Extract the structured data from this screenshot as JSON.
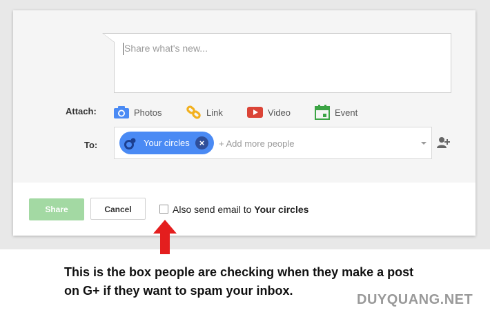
{
  "compose": {
    "placeholder": "Share what's new..."
  },
  "attach": {
    "label": "Attach:",
    "items": [
      {
        "label": "Photos",
        "icon": "camera-icon",
        "color": "#4a8af4"
      },
      {
        "label": "Link",
        "icon": "link-icon",
        "color": "#f2b01e"
      },
      {
        "label": "Video",
        "icon": "video-icon",
        "color": "#db4437"
      },
      {
        "label": "Event",
        "icon": "calendar-icon",
        "color": "#3ca445"
      }
    ]
  },
  "to": {
    "label": "To:",
    "chip_label": "Your circles",
    "chip_remove": "×",
    "add_placeholder": "+ Add more people",
    "chip_color": "#4a8af4"
  },
  "actions": {
    "share_label": "Share",
    "cancel_label": "Cancel",
    "email_checkbox_checked": false,
    "email_label_prefix": "Also send email to ",
    "email_label_bold": "Your circles"
  },
  "annotation": {
    "caption": "This is the box people are checking when they make a post on G+ if they want to spam your inbox.",
    "arrow_color": "#e41e1e"
  },
  "watermark": "DUYQUANG.NET"
}
